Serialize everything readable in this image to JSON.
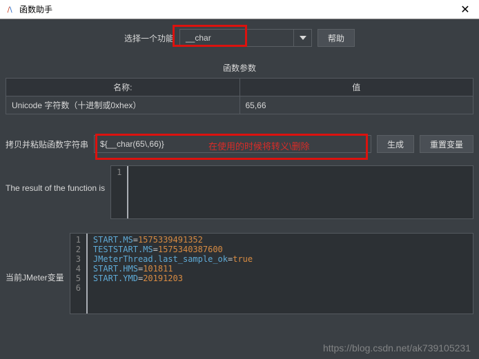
{
  "window": {
    "title": "函数助手",
    "close": "✕"
  },
  "selector": {
    "label": "选择一个功能",
    "value": "__char",
    "help_btn": "帮助"
  },
  "params": {
    "title": "函数参数",
    "header_name": "名称:",
    "header_value": "值",
    "rows": [
      {
        "name": "Unicode 字符数（十进制或0xhex）",
        "value": "65,66"
      }
    ]
  },
  "copy_row": {
    "label": "拷贝并粘贴函数字符串",
    "value": "${__char(65\\,66)}",
    "generate_btn": "生成",
    "reset_btn": "重置变量"
  },
  "result": {
    "label": "The result of the function is"
  },
  "vars": {
    "label": "当前JMeter变量",
    "lines": [
      {
        "k": "START.MS",
        "v": "1575339491352"
      },
      {
        "k": "TESTSTART.MS",
        "v": "1575340387600"
      },
      {
        "k": "JMeterThread.last_sample_ok",
        "v": "true"
      },
      {
        "k": "START.HMS",
        "v": "101811"
      },
      {
        "k": "START.YMD",
        "v": "20191203"
      }
    ]
  },
  "annotation": "在使用的时候将转义\\删除",
  "watermark": "https://blog.csdn.net/ak739105231"
}
